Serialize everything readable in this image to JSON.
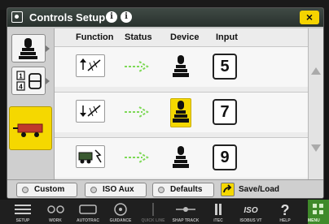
{
  "window": {
    "title": "Controls Setup",
    "info_icon_1": "i",
    "info_icon_2": "i",
    "close_label": "×"
  },
  "table": {
    "headers": {
      "function": "Function",
      "status": "Status",
      "device": "Device",
      "input": "Input"
    },
    "rows": [
      {
        "function_icon": "raise-function-icon",
        "input": "5"
      },
      {
        "function_icon": "lower-function-icon",
        "input": "7"
      },
      {
        "function_icon": "implement-function-icon",
        "input": "9"
      }
    ]
  },
  "sidebar": {
    "tabs": [
      {
        "name": "joystick-tab"
      },
      {
        "name": "mapping-tab",
        "line1": "1",
        "line2": "4"
      },
      {
        "name": "implement-tab",
        "active": true
      }
    ]
  },
  "bottom": {
    "custom": "Custom",
    "iso_aux": "ISO Aux",
    "defaults": "Defaults",
    "save_load": "Save/Load"
  },
  "taskbar": {
    "items": [
      "SETUP",
      "WORK",
      "AUTOTRAC",
      "GUIDANCE",
      "QUICK LINE",
      "SHAP TRACK",
      "iTEC",
      "ISOBUS VT",
      "HELP",
      "MENU"
    ],
    "iso_text": "ISO",
    "help_symbol": "?"
  },
  "colors": {
    "accent_yellow": "#f5d800",
    "menu_green": "#3f8a2a",
    "status_arrow": "#7ed957"
  }
}
